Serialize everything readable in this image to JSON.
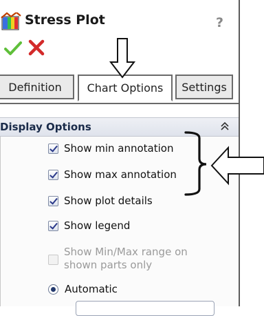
{
  "panel": {
    "title": "Stress Plot",
    "help": "?"
  },
  "tabs": [
    {
      "label": "Definition",
      "active": false
    },
    {
      "label": "Chart Options",
      "active": true
    },
    {
      "label": "Settings",
      "active": false
    }
  ],
  "display_options": {
    "header": "Display Options",
    "options": [
      {
        "label": "Show min annotation",
        "checked": true,
        "enabled": true
      },
      {
        "label": "Show max annotation",
        "checked": true,
        "enabled": true
      },
      {
        "label": "Show plot details",
        "checked": true,
        "enabled": true
      },
      {
        "label": "Show legend",
        "checked": true,
        "enabled": true
      },
      {
        "label": "Show Min/Max range on shown parts only",
        "label_line1": "Show Min/Max range on",
        "label_line2": "shown parts only",
        "checked": false,
        "enabled": false
      }
    ],
    "radio": {
      "label": "Automatic",
      "selected": true
    }
  },
  "colors": {
    "ok": "#5fbf3a",
    "cancel": "#d32a2a",
    "accent_header": "#1a2b4a"
  },
  "icons": [
    "stress-plot-icon",
    "help-icon",
    "ok-checkmark-icon",
    "cancel-x-icon",
    "collapse-chevrons-icon",
    "down-arrow-annotation",
    "left-arrow-annotation",
    "bracket-annotation"
  ]
}
